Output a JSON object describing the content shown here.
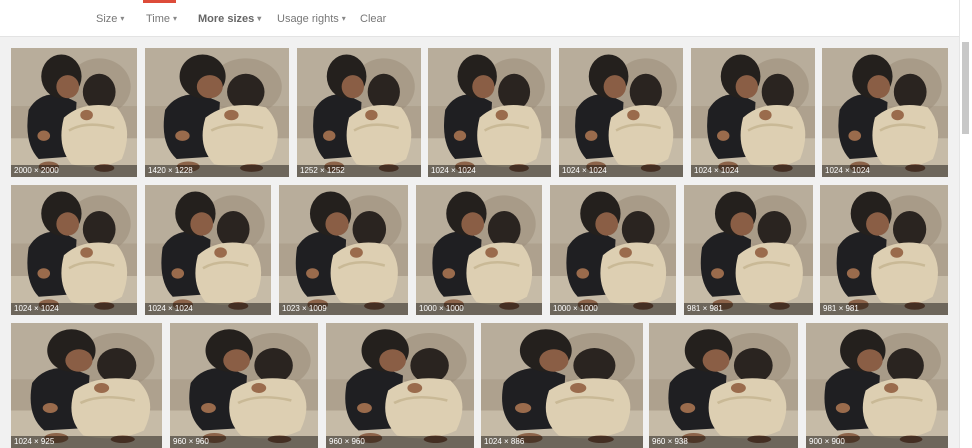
{
  "toolbar": {
    "items": [
      {
        "label": "Size",
        "caret": "▾"
      },
      {
        "label": "Time",
        "caret": "▾"
      },
      {
        "label": "More sizes",
        "caret": "▾"
      },
      {
        "label": "Usage rights",
        "caret": "▾"
      },
      {
        "label": "Clear"
      }
    ]
  },
  "results": [
    {
      "dims": "2000 × 2000"
    },
    {
      "dims": "1420 × 1228"
    },
    {
      "dims": "1252 × 1252"
    },
    {
      "dims": "1024 × 1024"
    },
    {
      "dims": "1024 × 1024"
    },
    {
      "dims": "1024 × 1024"
    },
    {
      "dims": "1024 × 1024"
    },
    {
      "dims": "1024 × 1024"
    },
    {
      "dims": "1024 × 1024"
    },
    {
      "dims": "1023 × 1009"
    },
    {
      "dims": "1000 × 1000"
    },
    {
      "dims": "1000 × 1000"
    },
    {
      "dims": "981 × 981"
    },
    {
      "dims": "981 × 981"
    },
    {
      "dims": "1024 × 925"
    },
    {
      "dims": "960 × 960"
    },
    {
      "dims": "960 × 960"
    },
    {
      "dims": "1024 × 886"
    },
    {
      "dims": "960 × 938"
    },
    {
      "dims": "900 × 900"
    }
  ],
  "colors": {
    "background": "#f1f1f1",
    "accent": "#dd4b39",
    "label_bg": "rgba(0,0,0,0.45)"
  },
  "icons": {
    "dropdown": "caret-down-icon"
  }
}
